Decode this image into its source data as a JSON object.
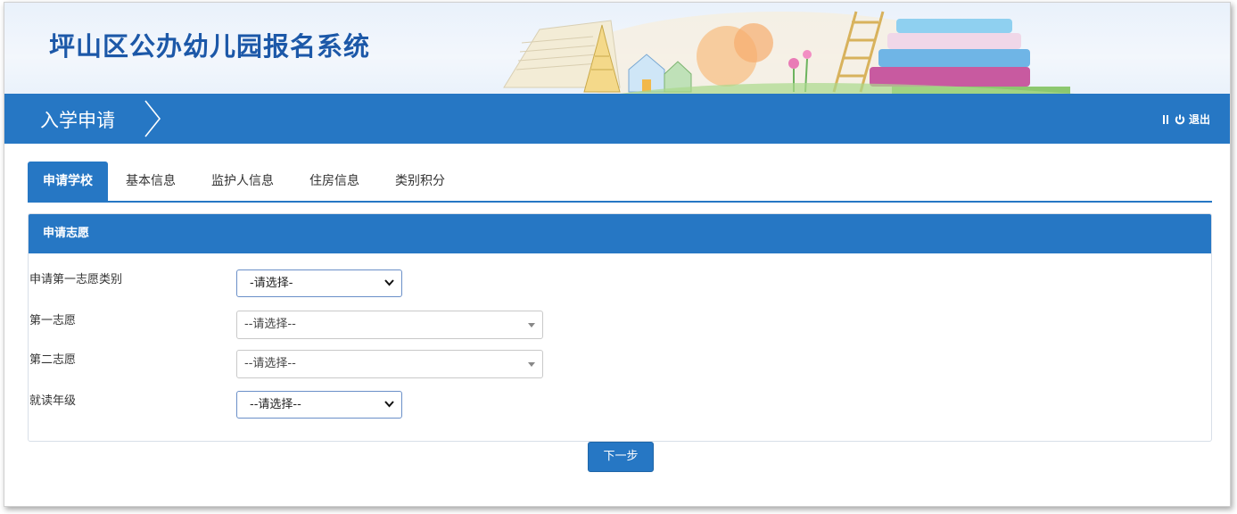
{
  "header": {
    "site_title": "坪山区公办幼儿园报名系统"
  },
  "titlebar": {
    "page_title": "入学申请",
    "logout_label": "退出"
  },
  "tabs": [
    {
      "label": "申请学校",
      "active": true
    },
    {
      "label": "基本信息",
      "active": false
    },
    {
      "label": "监护人信息",
      "active": false
    },
    {
      "label": "住房信息",
      "active": false
    },
    {
      "label": "类别积分",
      "active": false
    }
  ],
  "panel": {
    "title": "申请志愿",
    "fields": [
      {
        "label": "申请第一志愿类别",
        "value": "-请选择-"
      },
      {
        "label": "第一志愿",
        "value": "--请选择--"
      },
      {
        "label": "第二志愿",
        "value": "--请选择--"
      },
      {
        "label": "就读年级",
        "value": "--请选择--"
      }
    ]
  },
  "next_button_label": "下一步",
  "colors": {
    "primary": "#2677c4",
    "title_text": "#1c58a8"
  }
}
